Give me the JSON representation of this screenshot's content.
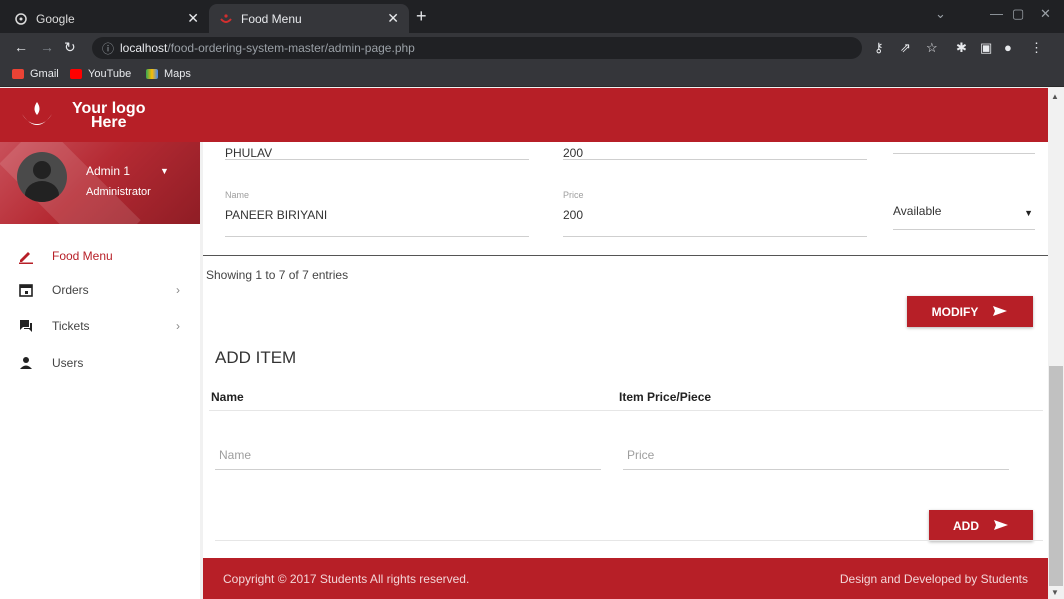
{
  "browser": {
    "tabs": [
      {
        "title": "Google",
        "active": false
      },
      {
        "title": "Food Menu",
        "active": true
      }
    ],
    "url_host": "localhost",
    "url_path": "/food-ordering-system-master/admin-page.php",
    "bookmarks": [
      "Gmail",
      "YouTube",
      "Maps"
    ]
  },
  "app": {
    "logo_line1": "Your logo",
    "logo_line2": "Here",
    "accent_color": "#b71f27"
  },
  "profile": {
    "name": "Admin 1",
    "role": "Administrator"
  },
  "sidebar": {
    "items": [
      {
        "label": "Food Menu",
        "icon": "pencil-icon",
        "active": true
      },
      {
        "label": "Orders",
        "icon": "calendar-icon",
        "arrow": true
      },
      {
        "label": "Tickets",
        "icon": "chat-icon",
        "arrow": true
      },
      {
        "label": "Users",
        "icon": "person-icon"
      }
    ]
  },
  "menu_rows": [
    {
      "name": "PHULAV",
      "price": "200"
    },
    {
      "name_label": "Name",
      "name": "PANEER BIRIYANI",
      "price_label": "Price",
      "price": "200",
      "status": "Available"
    }
  ],
  "table_info": "Showing 1 to 7 of 7 entries",
  "modify_button": "MODIFY",
  "add_item": {
    "title": "ADD ITEM",
    "col_name": "Name",
    "col_price": "Item Price/Piece",
    "name_placeholder": "Name",
    "price_placeholder": "Price",
    "add_button": "ADD"
  },
  "footer": {
    "left": "Copyright © 2017 Students All rights reserved.",
    "right": "Design and Developed by Students"
  }
}
